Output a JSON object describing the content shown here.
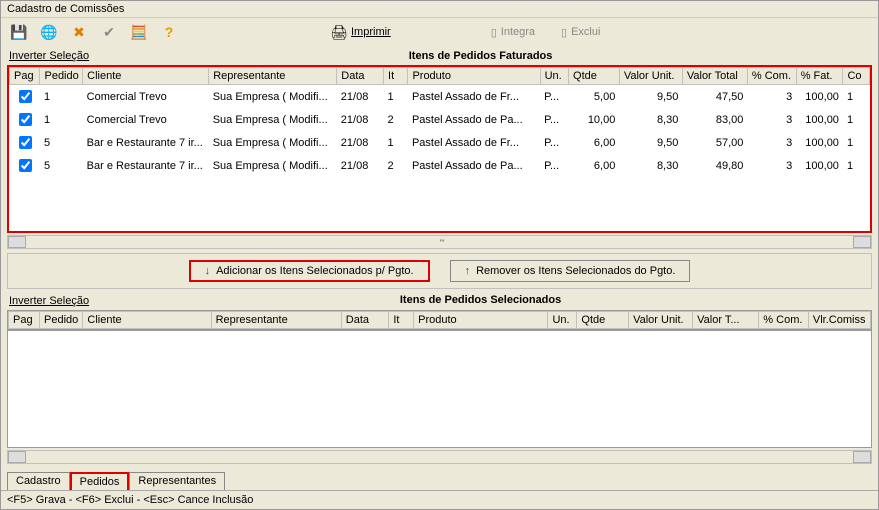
{
  "window": {
    "title": "Cadastro de Comissões"
  },
  "toolbar": {
    "save_icon": "💾",
    "globe_icon": "🌐",
    "delete_icon": "✖",
    "check_icon": "✔",
    "calc_icon": "🧮",
    "help_icon": "?",
    "print_icon": "🖨",
    "print_label": "Imprimir",
    "integra_label": "Integra",
    "exclui_label": "Exclui"
  },
  "top_section": {
    "invert_label": "Inverter Seleção",
    "title": "Itens de Pedidos Faturados",
    "columns": [
      "Pag",
      "Pedido",
      "Cliente",
      "Representante",
      "Data",
      "It",
      "Produto",
      "Un.",
      "Qtde",
      "Valor Unit.",
      "Valor Total",
      "% Com.",
      "% Fat.",
      "Co"
    ],
    "rows": [
      {
        "pag": true,
        "pedido": "1",
        "cliente": "Comercial Trevo",
        "rep": "Sua Empresa ( Modifi...",
        "data": "21/08",
        "it": "1",
        "produto": "Pastel Assado de Fr...",
        "un": "P...",
        "qtde": "5,00",
        "vu": "9,50",
        "vt": "47,50",
        "com": "3",
        "fat": "100,00",
        "cod": "1"
      },
      {
        "pag": true,
        "pedido": "1",
        "cliente": "Comercial Trevo",
        "rep": "Sua Empresa ( Modifi...",
        "data": "21/08",
        "it": "2",
        "produto": "Pastel Assado de Pa...",
        "un": "P...",
        "qtde": "10,00",
        "vu": "8,30",
        "vt": "83,00",
        "com": "3",
        "fat": "100,00",
        "cod": "1"
      },
      {
        "pag": true,
        "pedido": "5",
        "cliente": "Bar e Restaurante 7 ir...",
        "rep": "Sua Empresa ( Modifi...",
        "data": "21/08",
        "it": "1",
        "produto": "Pastel Assado de Fr...",
        "un": "P...",
        "qtde": "6,00",
        "vu": "9,50",
        "vt": "57,00",
        "com": "3",
        "fat": "100,00",
        "cod": "1"
      },
      {
        "pag": true,
        "pedido": "5",
        "cliente": "Bar e Restaurante 7 ir...",
        "rep": "Sua Empresa ( Modifi...",
        "data": "21/08",
        "it": "2",
        "produto": "Pastel Assado de Pa...",
        "un": "P...",
        "qtde": "6,00",
        "vu": "8,30",
        "vt": "49,80",
        "com": "3",
        "fat": "100,00",
        "cod": "1"
      }
    ]
  },
  "buttons": {
    "add_label": "Adicionar os Itens Selecionados p/ Pgto.",
    "remove_label": "Remover os Itens Selecionados do Pgto."
  },
  "bottom_section": {
    "invert_label": "Inverter Seleção",
    "title": "Itens de Pedidos Selecionados",
    "columns": [
      "Pag",
      "Pedido",
      "Cliente",
      "Representante",
      "Data",
      "It",
      "Produto",
      "Un.",
      "Qtde",
      "Valor Unit.",
      "Valor T...",
      "% Com.",
      "Vlr.Comiss"
    ]
  },
  "tabs": {
    "items": [
      "Cadastro",
      "Pedidos",
      "Representantes"
    ],
    "active": "Pedidos"
  },
  "statusbar": {
    "text": "<F5> Grava   -   <F6> Exclui   -   <Esc> Cance  Inclusão"
  },
  "scroll_marker": "'''"
}
